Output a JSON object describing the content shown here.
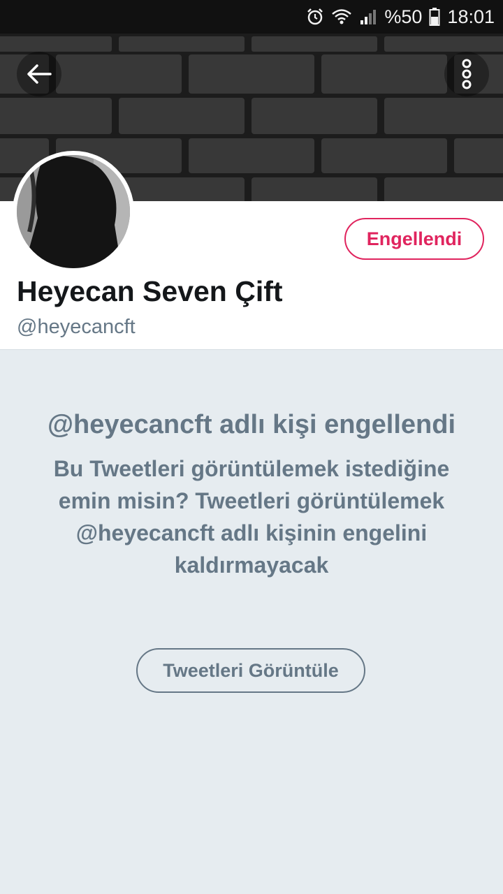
{
  "status_bar": {
    "battery_text": "%50",
    "time": "18:01",
    "icons": [
      "alarm-icon",
      "wifi-icon",
      "signal-icon",
      "battery-icon"
    ]
  },
  "header": {
    "back_icon": "arrow-left-icon",
    "more_icon": "more-vertical-icon"
  },
  "profile": {
    "display_name": "Heyecan Seven Çift",
    "handle": "@heyecancft",
    "blocked_button_label": "Engellendi"
  },
  "blocked_notice": {
    "title": "@heyecancft adlı kişi engellendi",
    "body": "Bu Tweetleri görüntülemek istediğine emin misin? Tweetleri görüntülemek @heyecancft adlı kişinin engelini kaldırmayacak",
    "view_button_label": "Tweetleri Görüntüle"
  },
  "colors": {
    "accent_blocked": "#e0245e",
    "muted_text": "#657786",
    "page_background": "#e6ecf0",
    "status_bar": "#111111"
  }
}
